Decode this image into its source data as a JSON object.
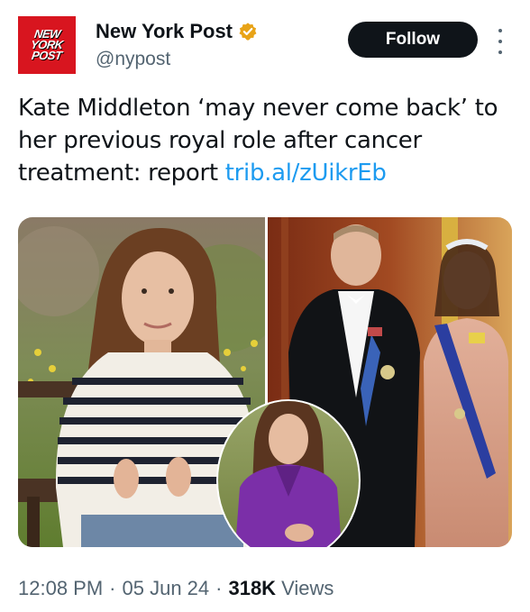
{
  "account": {
    "logo_lines": [
      "NEW",
      "YORK",
      "POST"
    ],
    "display_name": "New York Post",
    "handle": "@nypost",
    "verified_badge_color": "#e8a317"
  },
  "actions": {
    "follow_label": "Follow"
  },
  "tweet": {
    "text": "Kate Middleton ‘may never come back’ to her previous royal role after cancer treatment: report ",
    "link": "trib.al/zUikrEb",
    "link_color": "#1d9bf0"
  },
  "media": {
    "icon": "photo-collage",
    "description_colors": {
      "accent_purple": "#7b2fa8",
      "sash_blue": "#1f3f9f"
    }
  },
  "meta": {
    "time": "12:08 PM",
    "date": "05 Jun 24",
    "views_count": "318K",
    "views_label": "Views"
  }
}
